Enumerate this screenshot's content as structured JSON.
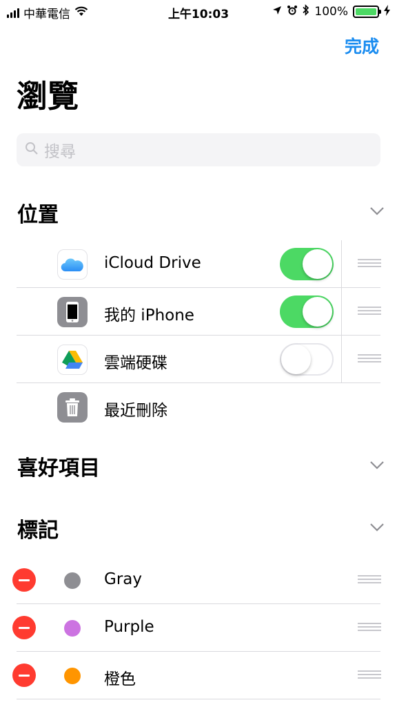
{
  "status_bar": {
    "carrier": "中華電信",
    "time": "上午10:03",
    "battery_percent": "100%",
    "battery_level": 1.0,
    "icons": [
      "signal-icon",
      "wifi-icon",
      "location-icon",
      "alarm-icon",
      "bluetooth-icon",
      "battery-icon",
      "charging-icon"
    ]
  },
  "header": {
    "done_label": "完成",
    "title": "瀏覽"
  },
  "search": {
    "placeholder": "搜尋"
  },
  "sections": {
    "locations": "位置",
    "favorites": "喜好項目",
    "tags": "標記"
  },
  "locations": [
    {
      "label": "iCloud Drive",
      "icon": "icloud-icon",
      "enabled": true
    },
    {
      "label": "我的 iPhone",
      "icon": "iphone-icon",
      "enabled": true
    },
    {
      "label": "雲端硬碟",
      "icon": "google-drive-icon",
      "enabled": false
    },
    {
      "label": "最近刪除",
      "icon": "trash-icon"
    }
  ],
  "tags": [
    {
      "label": "Gray",
      "color": "#8e8e93"
    },
    {
      "label": "Purple",
      "color": "#cc73e1"
    },
    {
      "label": "橙色",
      "color": "#ff9500"
    }
  ],
  "colors": {
    "accent": "#1a8cf0",
    "toggle_on": "#4cd964",
    "delete": "#ff3b30"
  }
}
